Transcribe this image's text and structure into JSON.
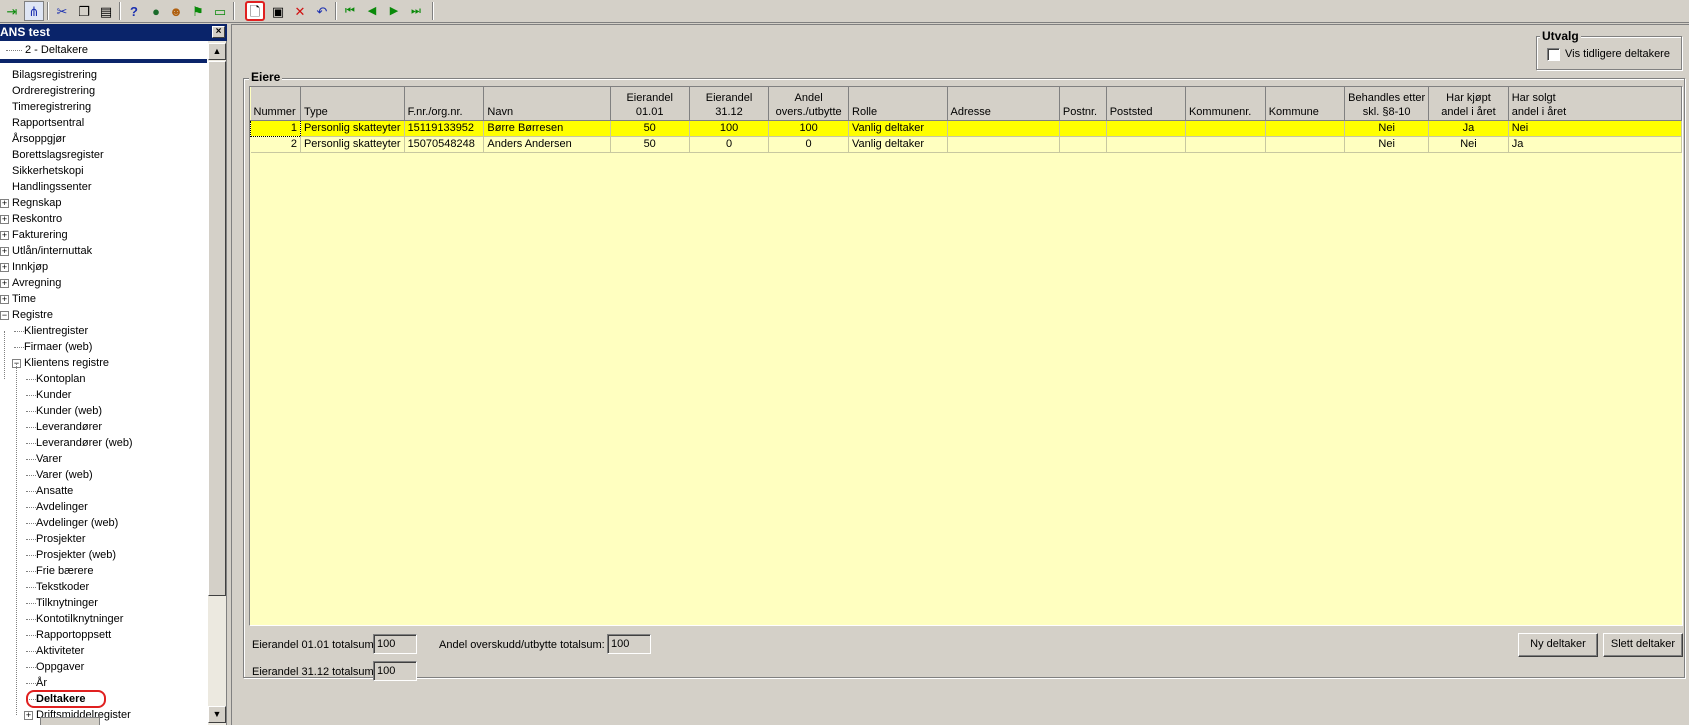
{
  "toolbar": {
    "icons": [
      "login-arrow-icon",
      "tree-structure-icon",
      "scissors-icon",
      "copy-icon",
      "paste-icon",
      "help-icon",
      "globe-icon",
      "users-icon",
      "flags-icon",
      "comment-icon",
      "new-document-icon",
      "save-disk-icon",
      "delete-x-icon",
      "undo-icon",
      "first-record-icon",
      "previous-record-icon",
      "next-record-icon",
      "last-record-icon"
    ]
  },
  "left_panel": {
    "title": "ANS test",
    "close_glyph": "×",
    "combo_value": "2 - Deltakere",
    "tree": [
      {
        "label": "Bilagsregistrering"
      },
      {
        "label": "Ordreregistrering"
      },
      {
        "label": "Timeregistrering"
      },
      {
        "label": "Rapportsentral"
      },
      {
        "label": "Årsoppgjør"
      },
      {
        "label": "Borettslagsregister"
      },
      {
        "label": "Sikkerhetskopi"
      },
      {
        "label": "Handlingssenter"
      },
      {
        "label": "Regnskap",
        "expander": "+"
      },
      {
        "label": "Reskontro",
        "expander": "+"
      },
      {
        "label": "Fakturering",
        "expander": "+"
      },
      {
        "label": "Utlån/internuttak",
        "expander": "+"
      },
      {
        "label": "Innkjøp",
        "expander": "+"
      },
      {
        "label": "Avregning",
        "expander": "+"
      },
      {
        "label": "Time",
        "expander": "+"
      },
      {
        "label": "Registre",
        "expander": "−"
      },
      {
        "label": "Klientregister"
      },
      {
        "label": "Firmaer (web)"
      },
      {
        "label": "Klientens registre",
        "expander": "−"
      },
      {
        "label": "Kontoplan"
      },
      {
        "label": "Kunder"
      },
      {
        "label": "Kunder (web)"
      },
      {
        "label": "Leverandører"
      },
      {
        "label": "Leverandører (web)"
      },
      {
        "label": "Varer"
      },
      {
        "label": "Varer (web)"
      },
      {
        "label": "Ansatte"
      },
      {
        "label": "Avdelinger"
      },
      {
        "label": "Avdelinger (web)"
      },
      {
        "label": "Prosjekter"
      },
      {
        "label": "Prosjekter (web)"
      },
      {
        "label": "Frie bærere"
      },
      {
        "label": "Tekstkoder"
      },
      {
        "label": "Tilknytninger"
      },
      {
        "label": "Kontotilknytninger"
      },
      {
        "label": "Rapportoppsett"
      },
      {
        "label": "Aktiviteter"
      },
      {
        "label": "Oppgaver"
      },
      {
        "label": "År"
      },
      {
        "label": "Deltakere",
        "selected": true
      },
      {
        "label": "Driftsmiddelregister",
        "expander": "+"
      }
    ]
  },
  "utvalg": {
    "legend": "Utvalg",
    "checkbox_label": "Vis tidligere deltakere",
    "checked": false
  },
  "eiere": {
    "legend": "Eiere",
    "columns": [
      {
        "line1": "",
        "line2": "Nummer"
      },
      {
        "line1": "",
        "line2": "Type"
      },
      {
        "line1": "",
        "line2": "F.nr./org.nr."
      },
      {
        "line1": "",
        "line2": "Navn"
      },
      {
        "line1": "Eierandel",
        "line2": "01.01"
      },
      {
        "line1": "Eierandel",
        "line2": "31.12"
      },
      {
        "line1": "Andel",
        "line2": "overs./utbytte"
      },
      {
        "line1": "",
        "line2": "Rolle"
      },
      {
        "line1": "",
        "line2": "Adresse"
      },
      {
        "line1": "",
        "line2": "Postnr."
      },
      {
        "line1": "",
        "line2": "Poststed"
      },
      {
        "line1": "",
        "line2": "Kommunenr."
      },
      {
        "line1": "",
        "line2": "Kommune"
      },
      {
        "line1": "Behandles etter",
        "line2": "skl. §8-10"
      },
      {
        "line1": "Har kjøpt",
        "line2": "andel i året"
      },
      {
        "line1": "Har solgt",
        "line2": "andel i året"
      }
    ],
    "rows": [
      [
        "1",
        "Personlig skatteyter",
        "15119133952",
        "Børre Børresen",
        "50",
        "100",
        "100",
        "Vanlig deltaker",
        "",
        "",
        "",
        "",
        "",
        "Nei",
        "Ja",
        "Nei"
      ],
      [
        "2",
        "Personlig skatteyter",
        "15070548248",
        "Anders Andersen",
        "50",
        "0",
        "0",
        "Vanlig deltaker",
        "",
        "",
        "",
        "",
        "",
        "Nei",
        "Nei",
        "Ja"
      ]
    ],
    "row_colors": {
      "selected": "#ffff00",
      "normal": "#ffffc0"
    }
  },
  "totals": {
    "eierandel_0101_label": "Eierandel 01.01 totalsum:",
    "eierandel_0101_value": "100",
    "andel_label": "Andel overskudd/utbytte totalsum:",
    "andel_value": "100",
    "eierandel_3112_label": "Eierandel 31.12 totalsum:",
    "eierandel_3112_value": "100"
  },
  "buttons": {
    "ny_deltaker": "Ny deltaker",
    "slett_deltaker": "Slett deltaker"
  }
}
